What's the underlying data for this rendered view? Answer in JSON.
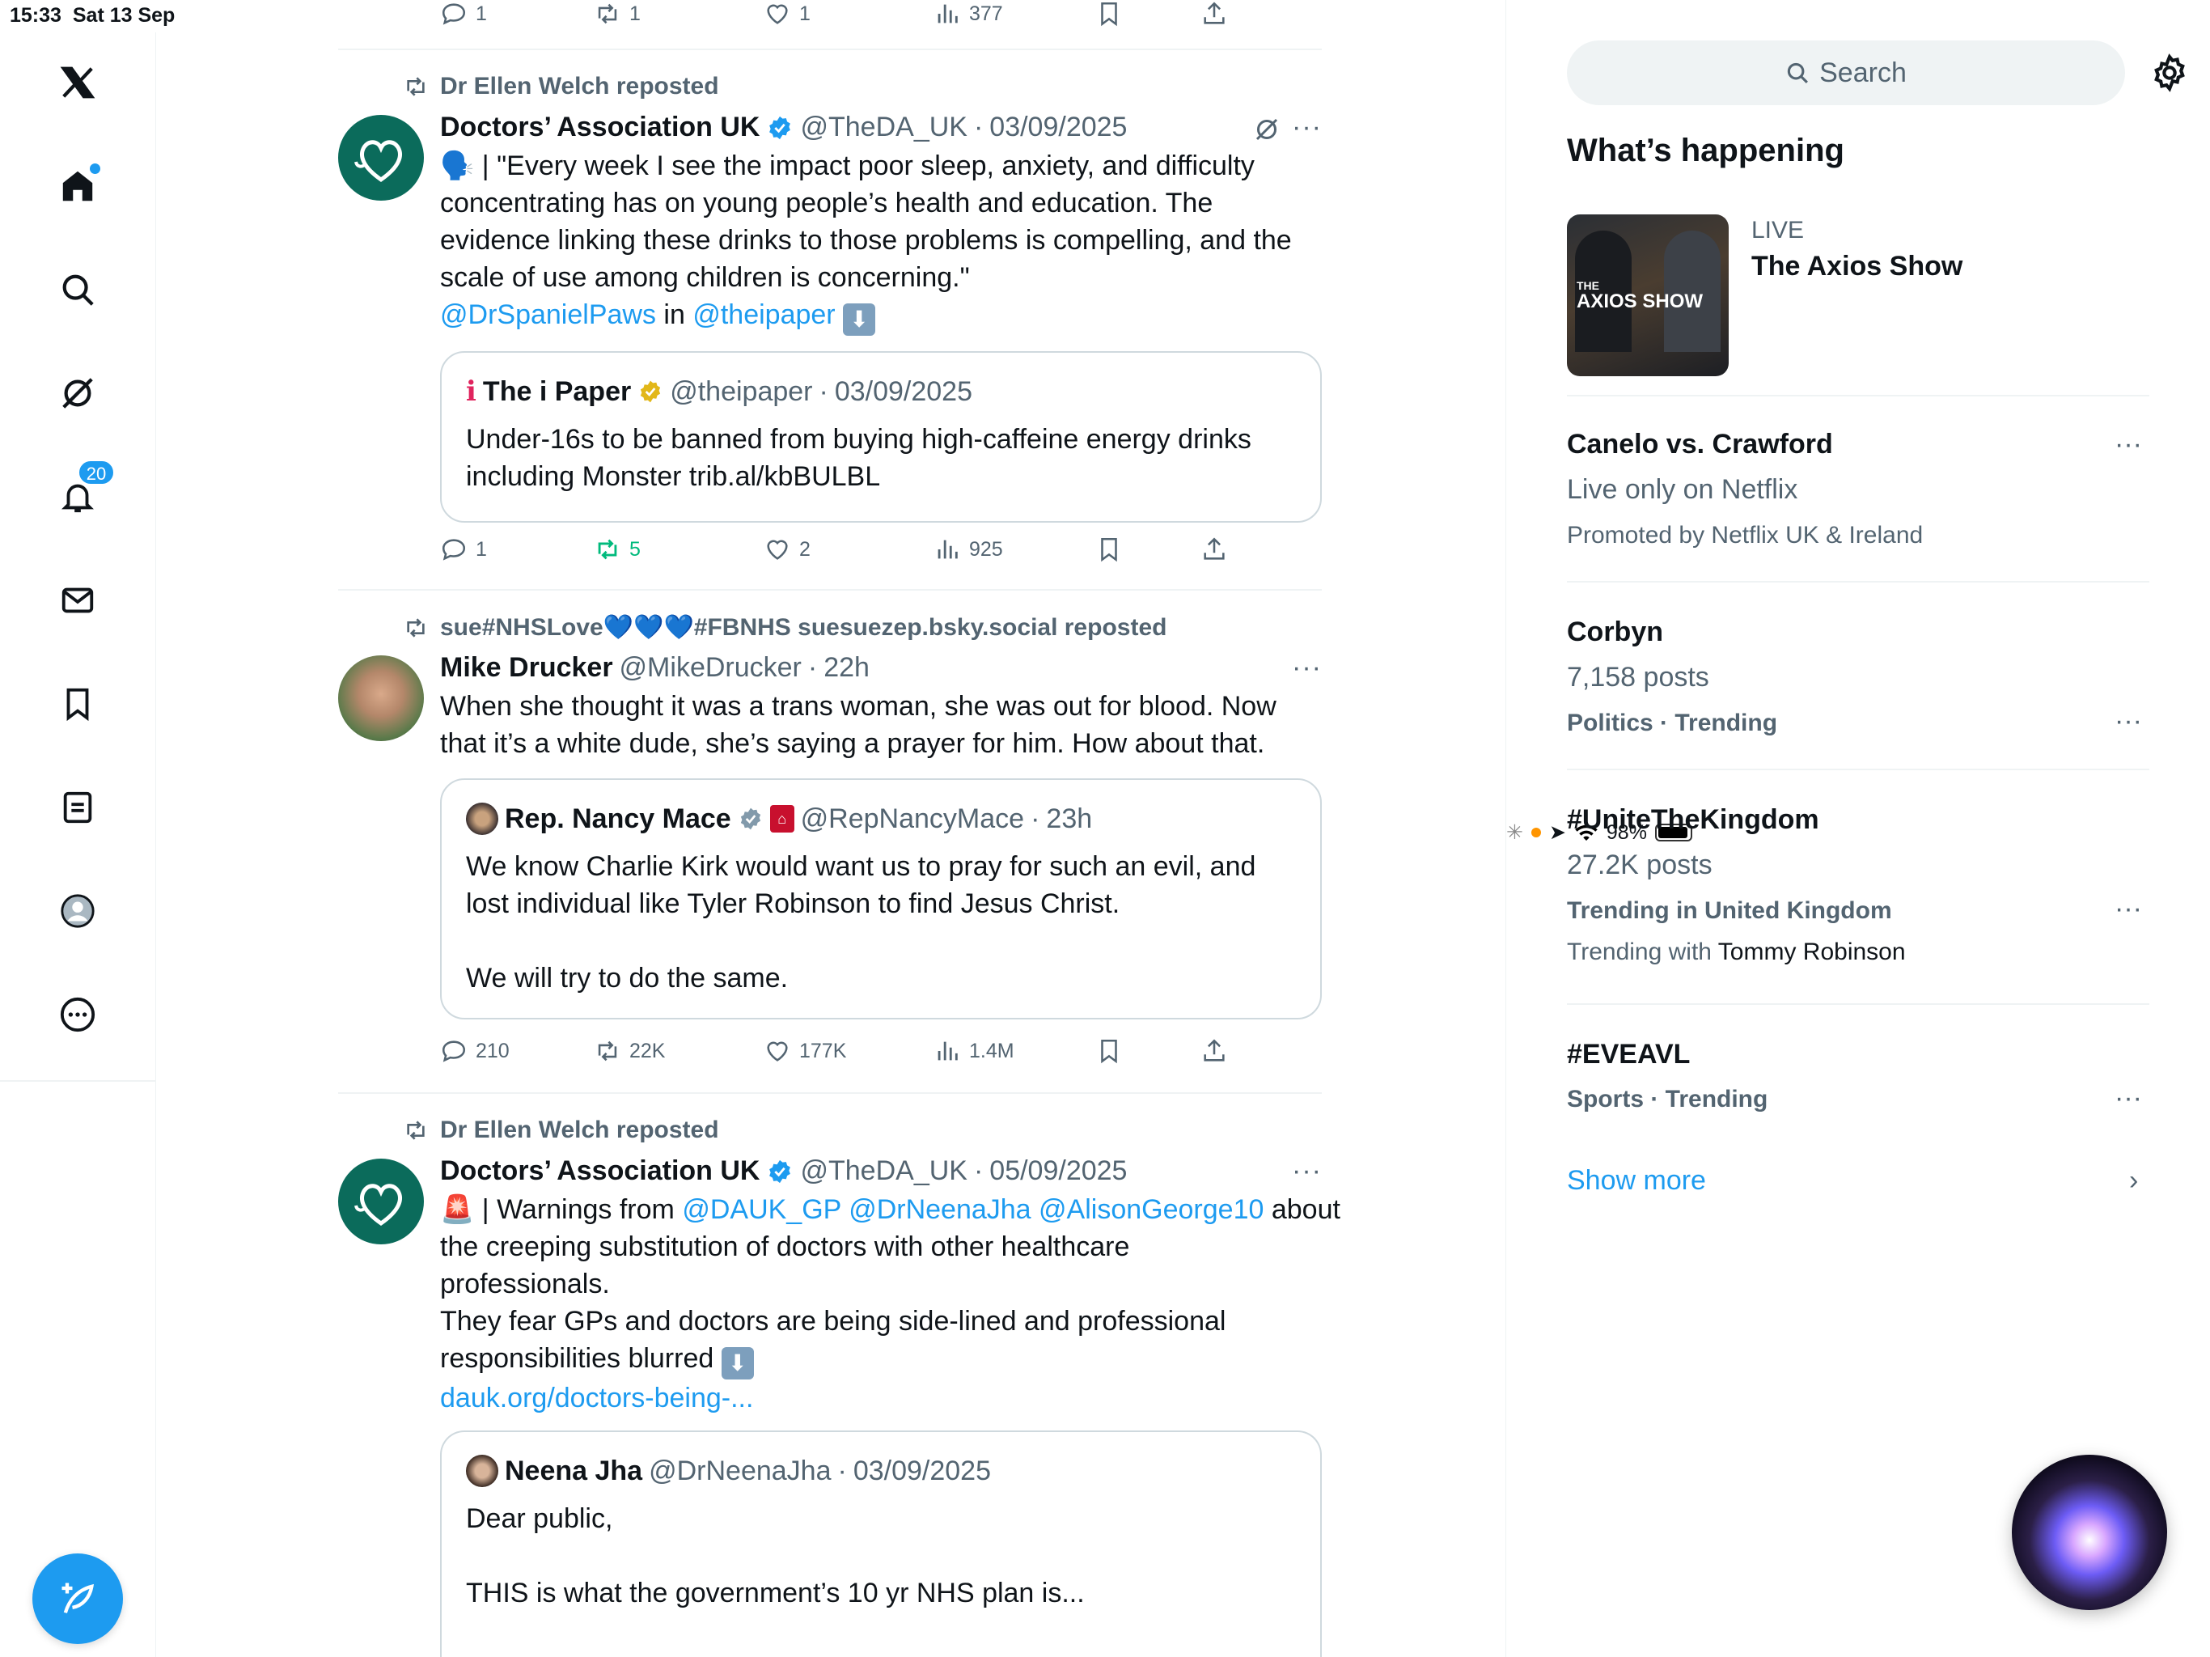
{
  "status_bar": {
    "time": "15:33",
    "date": "Sat 13 Sep",
    "battery": "98%"
  },
  "nav": {
    "items": [
      "home-icon",
      "search-icon",
      "grok-icon",
      "notifications-icon",
      "messages-icon",
      "bookmarks-icon",
      "lists-icon",
      "profile-icon",
      "more-icon"
    ],
    "notifications_badge": "20",
    "accent": "#1d9bf0"
  },
  "feed": {
    "top_actions": {
      "replies": "1",
      "reposts": "1",
      "likes": "1",
      "views": "377"
    },
    "posts": [
      {
        "repost_by": "Dr Ellen Welch reposted",
        "name": "Doctors’ Association UK",
        "handle": "@TheDA_UK",
        "date": "03/09/2025",
        "dot": "·",
        "text_line1": "| \"Every week I see the impact poor sleep, anxiety, and difficulty",
        "text_line2": "concentrating has on young people’s health and education. The",
        "text_line3": "evidence linking these drinks to those problems is compelling, and the",
        "text_line4": "scale of use among children is concerning.\"",
        "mention1": "@DrSpanielPaws",
        "in_text": "in",
        "mention2": "@theipaper",
        "quote": {
          "icon": "ℹ",
          "name": "The i Paper",
          "handle": "@theipaper",
          "date": "03/09/2025",
          "line1": "Under-16s to be banned from buying high-caffeine energy drinks",
          "line2": "including Monster trib.al/kbBULBL"
        },
        "actions": {
          "replies": "1",
          "reposts": "5",
          "likes": "2",
          "views": "925"
        }
      },
      {
        "repost_by": "sue#NHSLove💙💙💙#FBNHS suesuezep.bsky.social reposted",
        "name": "Mike Drucker",
        "handle": "@MikeDrucker",
        "date": "22h",
        "dot": "·",
        "text_line1": "When she thought it was a trans woman, she was out for blood. Now",
        "text_line2": "that it’s a white dude, she’s saying a prayer for him. How about that.",
        "quote": {
          "name": "Rep. Nancy Mace",
          "handle": "@RepNancyMace",
          "date": "23h",
          "line1": "We know Charlie Kirk would want us to pray for such an evil, and",
          "line2": "lost individual like Tyler Robinson to find Jesus Christ.",
          "line3": "We will try to do the same."
        },
        "actions": {
          "replies": "210",
          "reposts": "22K",
          "likes": "177K",
          "views": "1.4M"
        }
      },
      {
        "repost_by": "Dr Ellen Welch reposted",
        "name": "Doctors’ Association UK",
        "handle": "@TheDA_UK",
        "date": "05/09/2025",
        "dot": "·",
        "text_prefix": "| Warnings from",
        "mention1": "@DAUK_GP",
        "mention2": "@DrNeenaJha",
        "mention3": "@AlisonGeorge10",
        "text_about": "about",
        "text_line2": "the creeping substitution of doctors with other healthcare",
        "text_line3": "professionals.",
        "text_line4": "They fear GPs and doctors are being side-lined and professional",
        "text_line5": "responsibilities blurred",
        "link": "dauk.org/doctors-being-...",
        "quote": {
          "name": "Neena Jha",
          "handle": "@DrNeenaJha",
          "date": "03/09/2025",
          "line1": "Dear public,",
          "line2": "THIS is what the government’s 10 yr NHS plan is..."
        }
      }
    ]
  },
  "sidebar": {
    "search_placeholder": "Search",
    "heading": "What’s happening",
    "live": {
      "label": "LIVE",
      "title": "The Axios Show",
      "thumb_text_small": "THE",
      "thumb_text": "AXIOS SHOW"
    },
    "trends": [
      {
        "title": "Canelo vs. Crawford",
        "sub": "Live only on Netflix",
        "meta": "Promoted by Netflix UK & Ireland"
      },
      {
        "title": "Corbyn",
        "sub": "7,158 posts",
        "meta": "Politics · Trending"
      },
      {
        "title": "#UniteTheKingdom",
        "sub": "27.2K posts",
        "meta": "Trending in United Kingdom",
        "extra_prefix": "Trending with",
        "extra_name": "Tommy Robinson"
      },
      {
        "title": "#EVEAVL",
        "meta": "Sports · Trending"
      }
    ],
    "show_more": "Show more"
  }
}
